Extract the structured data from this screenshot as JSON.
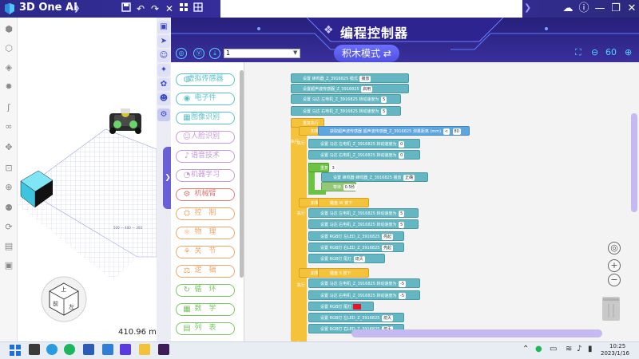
{
  "titlebar": {
    "app_name": "3D One AI",
    "logo_icon": "3d-one-logo-icon",
    "toolbar_icons": [
      "save-icon",
      "undo-icon",
      "redo-icon",
      "close-icon",
      "grid-icon",
      "layout-icon"
    ],
    "window_icons": [
      "cloud-icon",
      "info-icon",
      "minimize-icon",
      "restore-icon",
      "close-icon"
    ]
  },
  "viewport": {
    "dimension_value": "410.96 mm",
    "view_cube_labels": [
      "前",
      "左",
      "上"
    ]
  },
  "panel": {
    "title": "编程控制器",
    "mode_button": "积木模式",
    "mode_icon": "⇄",
    "device_select": "1",
    "zoom_level": "60"
  },
  "palette": [
    {
      "label": "虚拟传感器",
      "color": "#5bc0c9"
    },
    {
      "label": "电子件",
      "color": "#5bc0c9"
    },
    {
      "label": "图像识别",
      "color": "#5bc0c9"
    },
    {
      "label": "人脸识别",
      "color": "#c79ad8"
    },
    {
      "label": "语音技术",
      "color": "#c79ad8"
    },
    {
      "label": "机器学习",
      "color": "#c79ad8"
    },
    {
      "label": "机械臂",
      "color": "#e07878"
    },
    {
      "label": "控　制",
      "color": "#f0a66a"
    },
    {
      "label": "物　理",
      "color": "#f0a66a"
    },
    {
      "label": "关　节",
      "color": "#f0a66a"
    },
    {
      "label": "逻　辑",
      "color": "#f0a66a"
    },
    {
      "label": "循　环",
      "color": "#7bc464"
    },
    {
      "label": "数　学",
      "color": "#7bc464"
    },
    {
      "label": "列　表",
      "color": "#7bc464"
    }
  ],
  "blocks": {
    "b1": {
      "text": "设置 蜂鸣器_Z_3916825 模式",
      "slot": "播放"
    },
    "b2": {
      "text": "设置超声波传感器_Z_3916825",
      "slot": "启用"
    },
    "b3": {
      "text": "设置 马达 左电机_Z_3916825 转动速度为",
      "slot": "5"
    },
    "b4": {
      "text": "设置 马达 右电机_Z_3916825 转动速度为",
      "slot": "5"
    },
    "repeat_label": "重复执行",
    "if_label": "如果",
    "exec_label": "执行",
    "b5": {
      "text": "获取超声波传感器 超声波传感器_Z_3916825 测量距离 (mm)",
      "op": "<",
      "slot": "80"
    },
    "b6": {
      "text": "设置 马达 左电机_Z_3916825 转动速度为",
      "slot": "0"
    },
    "b7": {
      "text": "设置 马达 右电机_Z_3916825 转动速度为",
      "slot": "0"
    },
    "b8": {
      "text": "重复",
      "slot": "3"
    },
    "b9": {
      "text": "设置 蜂鸣器 蜂鸣器_Z_3916825 播放",
      "slot": "正确"
    },
    "b10": {
      "text": "等待",
      "slot": "0.5秒"
    },
    "b11": {
      "text": "键盘 W 按下"
    },
    "b12": {
      "text": "设置 马达 左电机_Z_3916825 转动速度为",
      "slot": "5"
    },
    "b13": {
      "text": "设置 马达 右电机_Z_3916825 转动速度为",
      "slot": "5"
    },
    "b14": {
      "text": "设置 RGB灯 左LED_Z_3916825",
      "slot": "亮起"
    },
    "b15": {
      "text": "设置 RGB灯 右LED_Z_3916825",
      "slot": "亮起"
    },
    "b16": {
      "text": "设置 RGB灯 尾灯",
      "slot": "熄灭"
    },
    "b17": {
      "text": "键盘 S 按下"
    },
    "b18": {
      "text": "设置 马达 左电机_Z_3916825 转动速度为",
      "slot": "-5"
    },
    "b19": {
      "text": "设置 马达 右电机_Z_3916825 转动速度为",
      "slot": "-5"
    },
    "b20": {
      "text": "设置 RGB灯 尾灯"
    },
    "b21": {
      "text": "设置 RGB灯 左LED_Z_3916825",
      "slot": "熄灭"
    },
    "b22": {
      "text": "设置 RGB灯 右LED_Z_3916825",
      "slot": "熄灭"
    }
  },
  "taskbar": {
    "time": "10:25",
    "date": "2023/1/16",
    "tray_icons": [
      "chevron-up-icon",
      "wechat-icon",
      "phone-link-icon",
      "wifi-icon",
      "speaker-icon",
      "battery-icon"
    ]
  }
}
